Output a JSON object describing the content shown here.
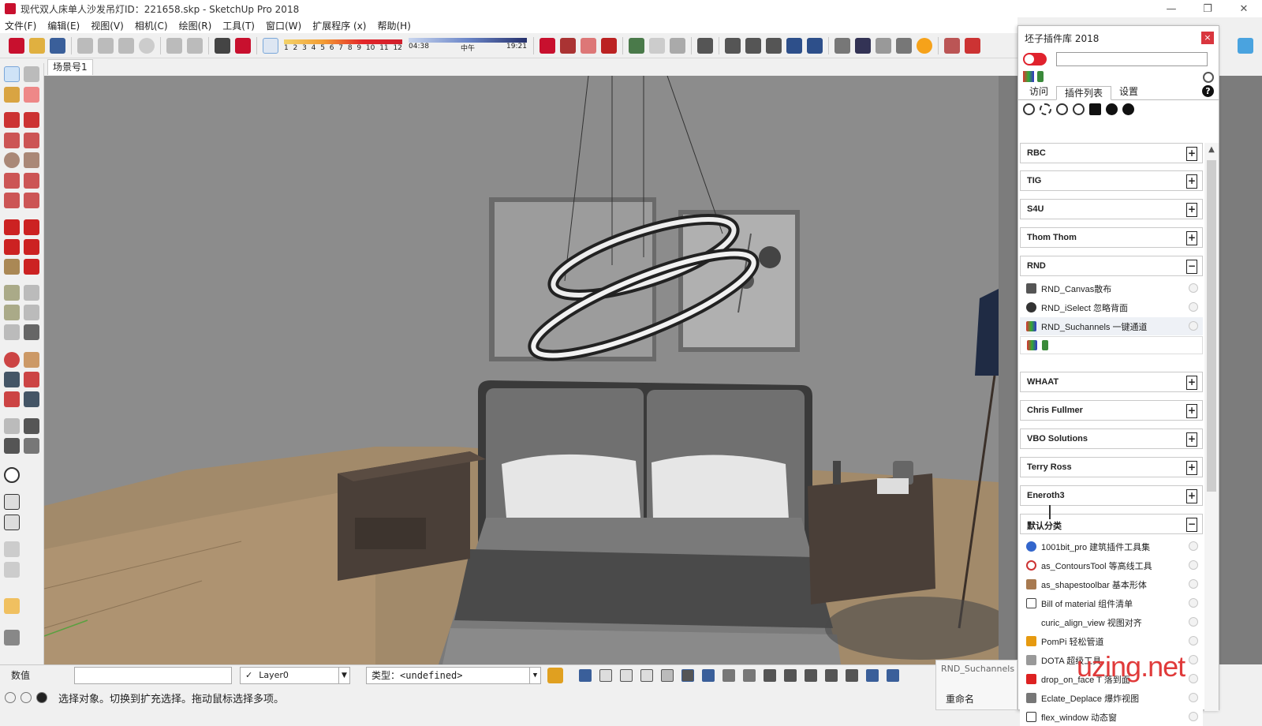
{
  "window": {
    "title": "现代双人床单人沙发吊灯ID：221658.skp - SketchUp Pro 2018",
    "controls": [
      "—",
      "❐",
      "✕"
    ]
  },
  "menu": [
    "文件(F)",
    "编辑(E)",
    "视图(V)",
    "相机(C)",
    "绘图(R)",
    "工具(T)",
    "窗口(W)",
    "扩展程序 (x)",
    "帮助(H)"
  ],
  "shadow": {
    "months": [
      "1",
      "2",
      "3",
      "4",
      "5",
      "6",
      "7",
      "8",
      "9",
      "10",
      "11",
      "12"
    ],
    "time_start": "04:38",
    "time_mid": "中午",
    "time_end": "19:21"
  },
  "scene_tab": "场景号1",
  "plugin_panel": {
    "title": "坯子插件库 2018",
    "close": "×",
    "search_value": "",
    "tabs": [
      "访问",
      "插件列表",
      "设置"
    ],
    "active_tab": "插件列表",
    "help": "?",
    "groups": [
      {
        "label": "RBC",
        "toggle": "+"
      },
      {
        "label": "TIG",
        "toggle": "+"
      },
      {
        "label": "S4U",
        "toggle": "+"
      },
      {
        "label": "Thom Thom",
        "toggle": "+"
      },
      {
        "label": "RND",
        "toggle": "−"
      },
      {
        "label": "WHAAT",
        "toggle": "+"
      },
      {
        "label": "Chris Fullmer",
        "toggle": "+"
      },
      {
        "label": "VBO Solutions",
        "toggle": "+"
      },
      {
        "label": "Terry Ross",
        "toggle": "+"
      },
      {
        "label": "Eneroth3",
        "toggle": "+"
      },
      {
        "label": "默认分类",
        "toggle": "−"
      }
    ],
    "rnd_items": [
      "RND_Canvas散布",
      "RND_iSelect 忽略背面",
      "RND_Suchannels 一键通道"
    ],
    "default_items": [
      "1001bit_pro 建筑插件工具集",
      "as_ContoursTool 等高线工具",
      "as_shapestoolbar 基本形体",
      "Bill of material 组件清单",
      "curic_align_view 视图对齐",
      "PomPi 轻松管道",
      "DOTA 超级工具",
      "drop_on_face T 落到面",
      "Eclate_Deplace 爆炸视图",
      "flex_window 动态窗"
    ]
  },
  "status": {
    "measure_label": "数值",
    "layer": "Layer0",
    "layer_check": "✓",
    "type_label": "类型：",
    "type_value": "<undefined>",
    "hint": "选择对象。切换到扩充选择。拖动鼠标选择多项。"
  },
  "sub_panel": {
    "title": "RND_Suchannels",
    "button": "重命名"
  },
  "watermark": "uzing.net",
  "colors": {
    "accent_red": "#e0222d",
    "viewport_bg": "#8a8a8a",
    "floor": "#a08868"
  }
}
